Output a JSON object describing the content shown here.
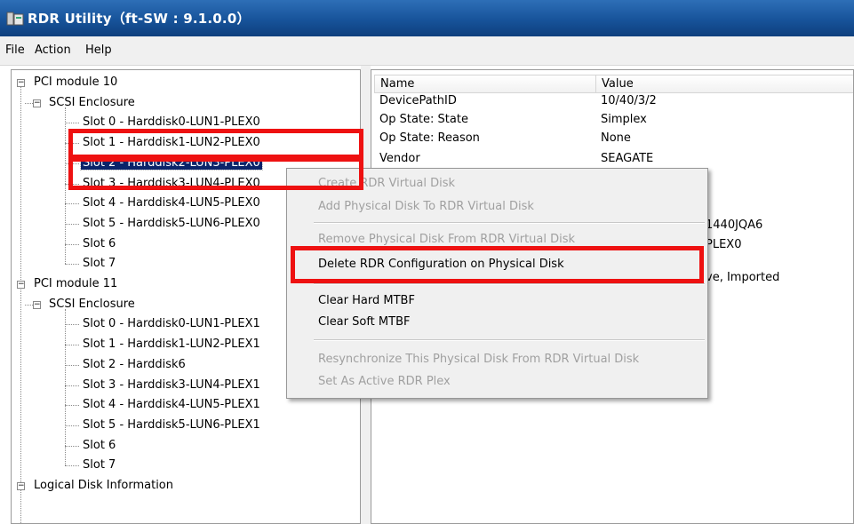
{
  "window": {
    "title": "RDR Utility（ft-SW : 9.1.0.0）"
  },
  "menu": [
    "File",
    "Action",
    "Help"
  ],
  "tree": {
    "nodes": [
      {
        "label": "PCI module 10",
        "level": 0,
        "expander": "−"
      },
      {
        "label": "SCSI Enclosure",
        "level": 1,
        "expander": "−"
      },
      {
        "label": "Slot 0  -  Harddisk0-LUN1-PLEX0",
        "level": 2
      },
      {
        "label": "Slot 1  -  Harddisk1-LUN2-PLEX0",
        "level": 2
      },
      {
        "label": "Slot 2  -  Harddisk2-LUN3-PLEX0",
        "level": 2,
        "selected": true
      },
      {
        "label": "Slot 3  -  Harddisk3-LUN4-PLEX0",
        "level": 2
      },
      {
        "label": "Slot 4  -  Harddisk4-LUN5-PLEX0",
        "level": 2
      },
      {
        "label": "Slot 5  -  Harddisk5-LUN6-PLEX0",
        "level": 2
      },
      {
        "label": "Slot 6",
        "level": 2
      },
      {
        "label": "Slot 7",
        "level": 2
      },
      {
        "label": "PCI module 11",
        "level": 0,
        "expander": "−"
      },
      {
        "label": "SCSI Enclosure",
        "level": 1,
        "expander": "−"
      },
      {
        "label": "Slot 0  -  Harddisk0-LUN1-PLEX1",
        "level": 2
      },
      {
        "label": "Slot 1  -  Harddisk1-LUN2-PLEX1",
        "level": 2
      },
      {
        "label": "Slot 2  -  Harddisk6",
        "level": 2
      },
      {
        "label": "Slot 3  -  Harddisk3-LUN4-PLEX1",
        "level": 2
      },
      {
        "label": "Slot 4  -  Harddisk4-LUN5-PLEX1",
        "level": 2
      },
      {
        "label": "Slot 5  -  Harddisk5-LUN6-PLEX1",
        "level": 2
      },
      {
        "label": "Slot 6",
        "level": 2
      },
      {
        "label": "Slot 7",
        "level": 2
      },
      {
        "label": "Logical Disk Information",
        "level": 0,
        "expander": "−"
      }
    ]
  },
  "properties": {
    "columns": [
      "Name",
      "Value"
    ],
    "rows": [
      {
        "name": "DevicePathID",
        "value": "10/40/3/2"
      },
      {
        "name": "Op State: State",
        "value": "Simplex"
      },
      {
        "name": "Op State: Reason",
        "value": "None"
      },
      {
        "name": "Vendor",
        "value": "SEAGATE"
      }
    ],
    "partial_values": [
      "1440JQA6",
      "PLEX0",
      "ve, Imported"
    ]
  },
  "context_menu": {
    "items": [
      {
        "label": "Create RDR Virtual Disk",
        "enabled": false
      },
      {
        "label": "Add Physical Disk To RDR Virtual Disk",
        "enabled": false
      },
      {
        "separator": true
      },
      {
        "label": "Remove Physical Disk From RDR Virtual Disk",
        "enabled": false
      },
      {
        "label": "Delete RDR Configuration on Physical Disk",
        "enabled": true,
        "highlighted": true
      },
      {
        "separator": true
      },
      {
        "label": "Clear Hard MTBF",
        "enabled": true
      },
      {
        "label": "Clear Soft MTBF",
        "enabled": true
      },
      {
        "separator": true
      },
      {
        "label": "Resynchronize This Physical Disk From RDR Virtual Disk",
        "enabled": false
      },
      {
        "label": "Set As Active RDR Plex",
        "enabled": false
      }
    ]
  },
  "colors": {
    "titlebar": "#17539a",
    "selection": "#0a246a",
    "highlight_box": "#ee1111",
    "disabled_text": "#a0a0a0"
  }
}
